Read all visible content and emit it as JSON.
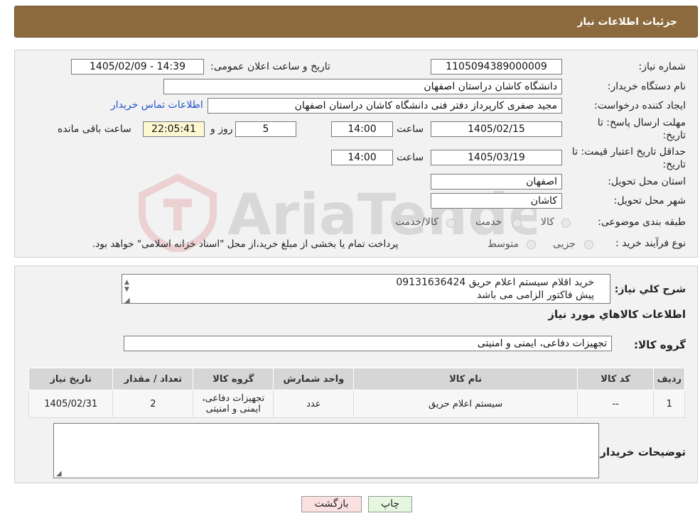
{
  "header": {
    "title": "جزئیات اطلاعات نیاز"
  },
  "form": {
    "need_number_label": "شماره نیاز:",
    "need_number": "1105094389000009",
    "announce_label": "تاریخ و ساعت اعلان عمومی:",
    "announce_value": "1405/02/09 - 14:39",
    "buyer_org_label": "نام دستگاه خریدار:",
    "buyer_org": "دانشگاه کاشان دراستان اصفهان",
    "creator_label": "ایجاد کننده درخواست:",
    "creator": "مجید صفری کارپرداز دفتر فنی دانشگاه کاشان دراستان اصفهان",
    "contact_link": "اطلاعات تماس خریدار",
    "deadline_label_1": "مهلت ارسال پاسخ: تا",
    "deadline_label_2": "تاریخ:",
    "deadline_date": "1405/02/15",
    "time_label": "ساعت",
    "deadline_time": "14:00",
    "days_value": "5",
    "days_label": "روز و",
    "remaining_time": "22:05:41",
    "remaining_label": "ساعت باقی مانده",
    "validity_label_1": "حداقل تاریخ اعتبار قیمت: تا",
    "validity_label_2": "تاریخ:",
    "validity_date": "1405/03/19",
    "validity_time_label": "ساعت",
    "validity_time": "14:00",
    "province_label": "استان محل تحویل:",
    "province": "اصفهان",
    "city_label": "شهر محل تحویل:",
    "city": "کاشان",
    "category_label": "طبقه بندی موضوعی:",
    "category_options": [
      "کالا",
      "خدمت",
      "کالا/خدمت"
    ],
    "process_label": "نوع فرآیند خرید :",
    "process_options": [
      "جزیی",
      "متوسط"
    ],
    "process_note": "پرداخت تمام یا بخشی از مبلغ خرید،از محل \"اسناد خزانه اسلامی\" خواهد بود."
  },
  "details": {
    "summary_label": "شرح کلي نیاز:",
    "summary_line1": "خرید اقلام سیستم اعلام حریق 09131636424",
    "summary_line2": "پیش فاکتور الزامی می باشد",
    "goods_info_title": "اطلاعات کالاهاي مورد نیاز",
    "goods_group_label": "گروه کالا:",
    "goods_group": "تجهیزات دفاعی، ایمنی و امنیتی",
    "table_headers": [
      "ردیف",
      "کد کالا",
      "نام کالا",
      "واحد شمارش",
      "گروه کالا",
      "تعداد / مقدار",
      "تاریخ نیاز"
    ],
    "rows": [
      [
        "1",
        "--",
        "سیستم اعلام حریق",
        "عدد",
        "تجهیزات دفاعی، ایمنی و امنیتی",
        "2",
        "1405/02/31"
      ]
    ],
    "buyer_notes_label": "توضیحات خریدار:",
    "buyer_notes": ""
  },
  "buttons": {
    "print": "چاپ",
    "back": "بازگشت"
  },
  "colors": {
    "header_bg": "#8c6a3d",
    "back_button_bg": "#fbe0e0",
    "print_button_bg": "#e6f7e0"
  },
  "watermark": {
    "text": "AriaTender.neT"
  }
}
